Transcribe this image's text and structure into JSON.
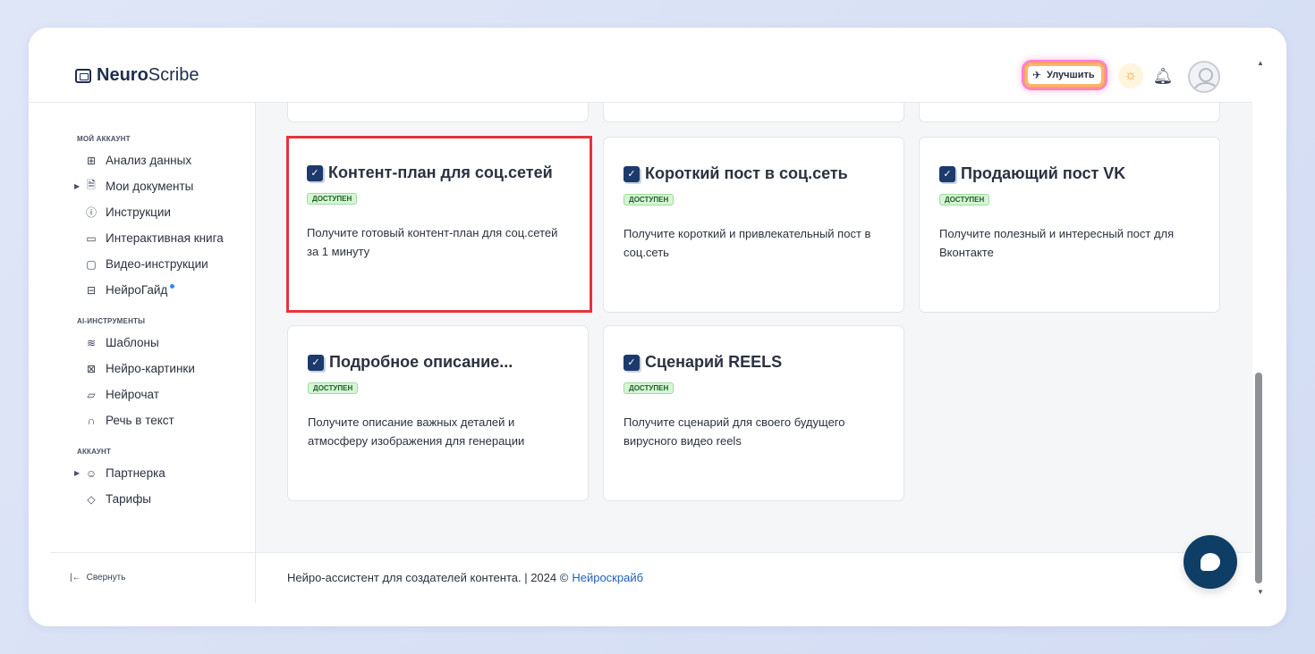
{
  "header": {
    "logo_bold": "Neuro",
    "logo_light": "Scribe",
    "upgrade_label": "Улучшить"
  },
  "sidebar": {
    "sections": [
      {
        "title": "МОЙ АККАУНТ",
        "items": [
          {
            "label": "Анализ данных",
            "icon": "grid-icon"
          },
          {
            "label": "Мои документы",
            "icon": "document-icon"
          },
          {
            "label": "Инструкции",
            "icon": "help-icon"
          },
          {
            "label": "Интерактивная книга",
            "icon": "book-icon"
          },
          {
            "label": "Видео-инструкции",
            "icon": "video-icon"
          },
          {
            "label": "НейроГайд",
            "icon": "guide-icon"
          }
        ]
      },
      {
        "title": "AI-ИНСТРУМЕНТЫ",
        "items": [
          {
            "label": "Шаблоны",
            "icon": "layers-icon"
          },
          {
            "label": "Нейро-картинки",
            "icon": "image-icon"
          },
          {
            "label": "Нейрочат",
            "icon": "chat-icon"
          },
          {
            "label": "Речь в текст",
            "icon": "headphones-icon"
          }
        ]
      },
      {
        "title": "АККАУНТ",
        "items": [
          {
            "label": "Партнерка",
            "icon": "users-icon"
          },
          {
            "label": "Тарифы",
            "icon": "tag-icon"
          }
        ]
      }
    ],
    "collapse_label": "Свернуть"
  },
  "cards": [
    {
      "title": "Контент-план для соц.сетей",
      "badge": "ДОСТУПЕН",
      "desc": "Получите готовый контент-план для соц.сетей за 1 минуту"
    },
    {
      "title": "Короткий пост в соц.сеть",
      "badge": "ДОСТУПЕН",
      "desc": "Получите короткий и привлекательный пост в соц.сеть"
    },
    {
      "title": "Продающий пост VK",
      "badge": "ДОСТУПЕН",
      "desc": "Получите полезный и интересный пост для Вконтакте"
    },
    {
      "title": "Подробное описание...",
      "badge": "ДОСТУПЕН",
      "desc": "Получите описание важных деталей и атмосферу изображения для генерации"
    },
    {
      "title": "Сценарий REELS",
      "badge": "ДОСТУПЕН",
      "desc": "Получите сценарий для своего будущего вирусного видео reels"
    }
  ],
  "footer": {
    "text": "Нейро-ассистент для создателей контента.  | 2024 ©",
    "brand": "Нейроскрайб"
  },
  "colors": {
    "accent": "#1c3a6c",
    "highlight": "#e5343d",
    "badge_bg": "#d6f5d6"
  }
}
